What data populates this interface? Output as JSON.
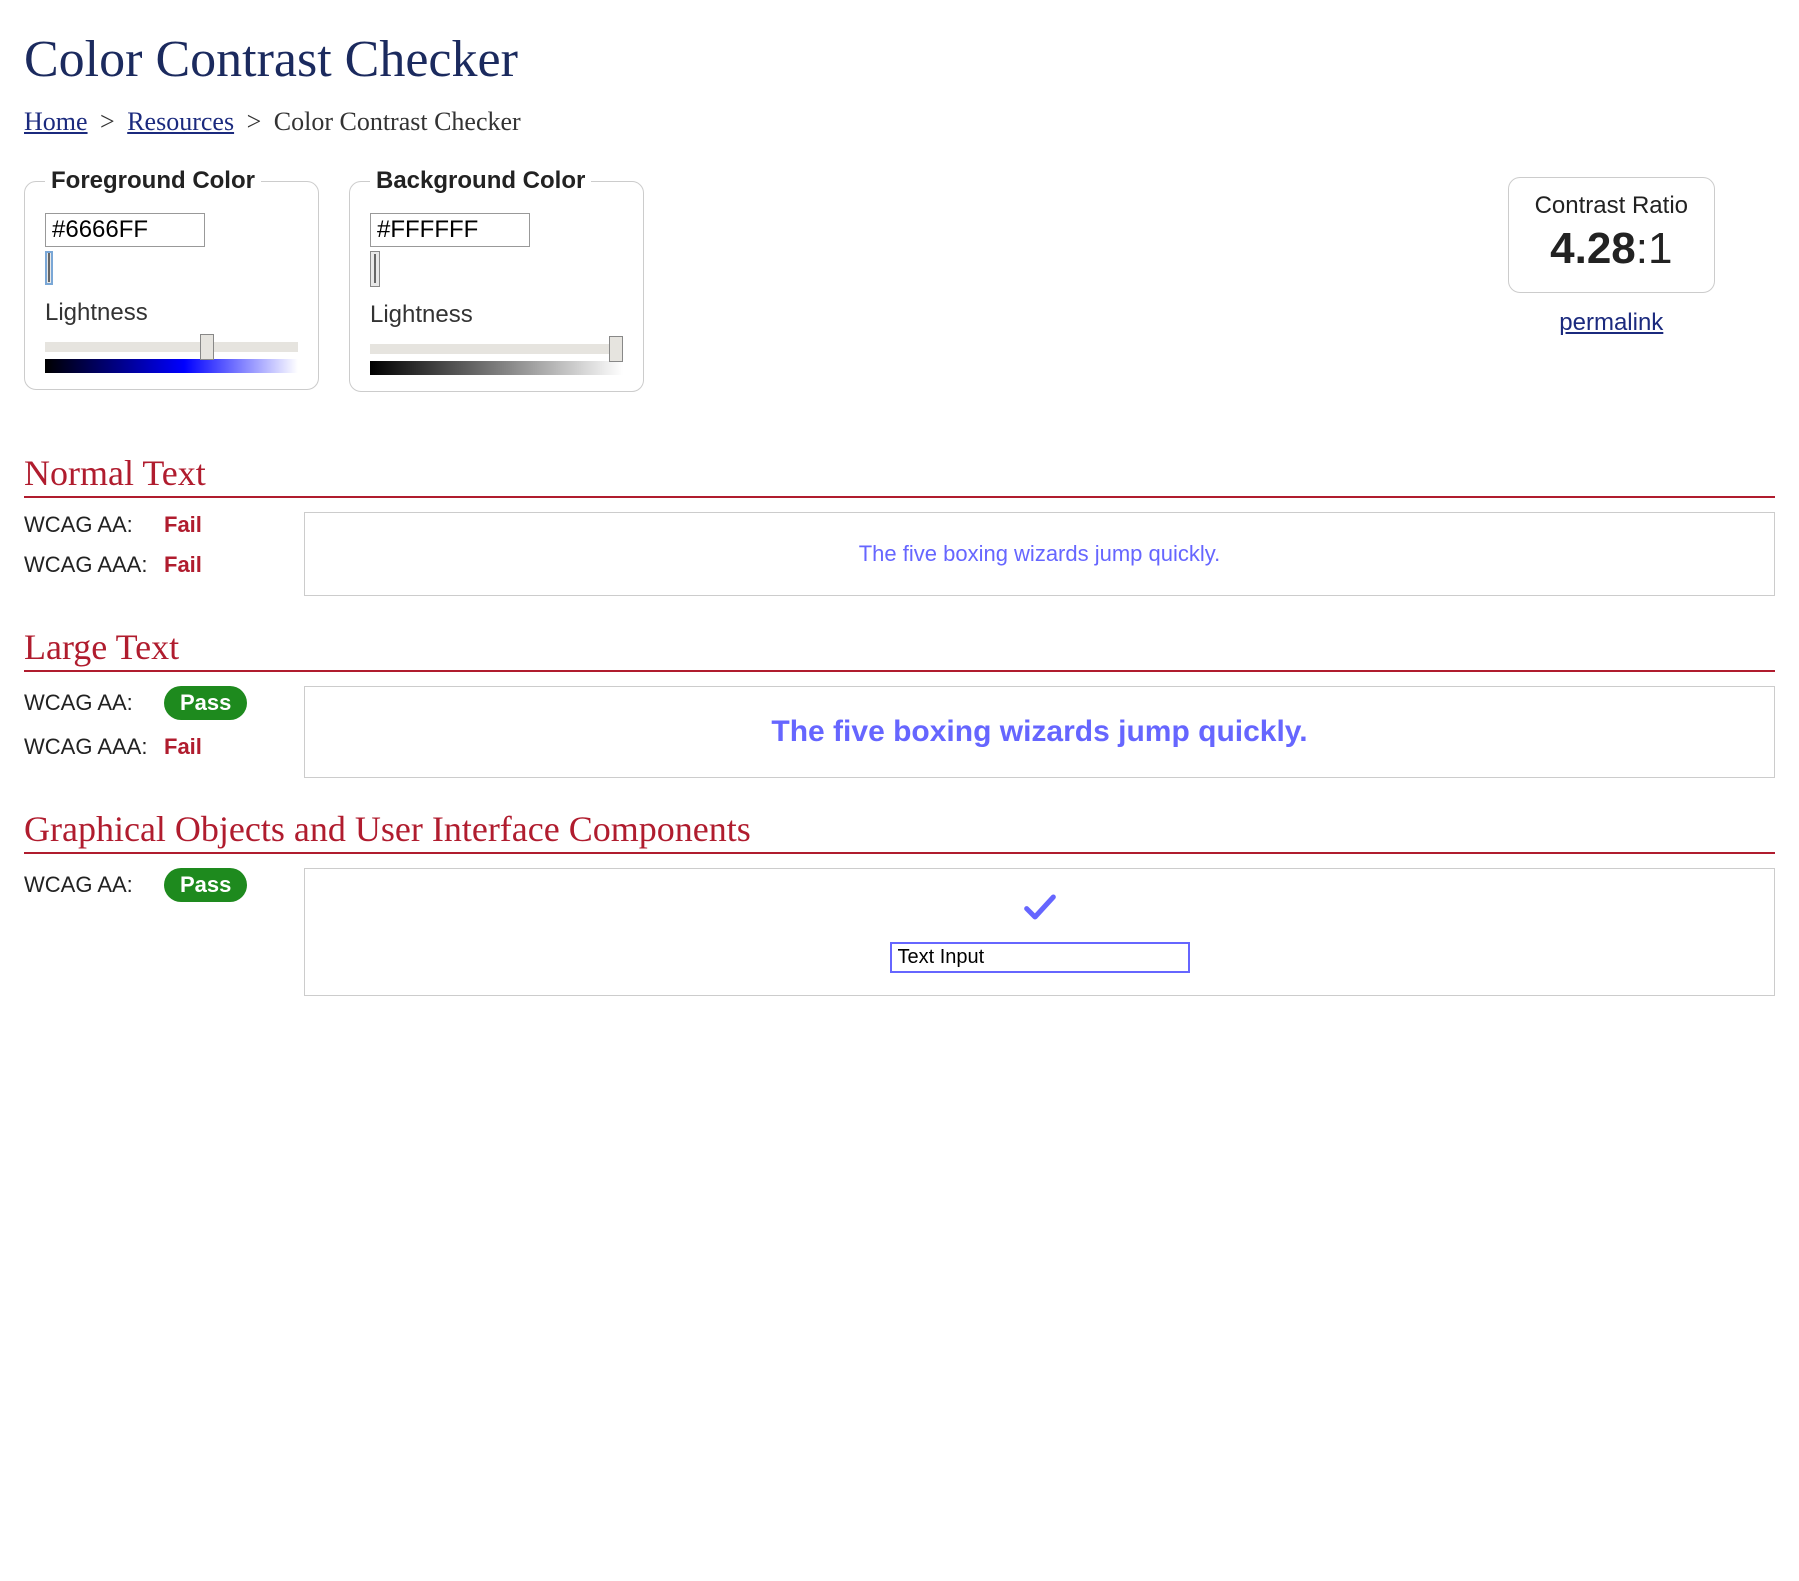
{
  "title": "Color Contrast Checker",
  "breadcrumb": {
    "home": "Home",
    "resources": "Resources",
    "current": "Color Contrast Checker",
    "sep": ">"
  },
  "foreground": {
    "legend": "Foreground Color",
    "hex": "#6666FF",
    "lightness_label": "Lightness",
    "slider_value": 65
  },
  "background": {
    "legend": "Background Color",
    "hex": "#FFFFFF",
    "lightness_label": "Lightness",
    "slider_value": 100
  },
  "ratio": {
    "title": "Contrast Ratio",
    "value": "4.28",
    "suffix": ":1",
    "permalink": "permalink"
  },
  "sections": {
    "normal": {
      "heading": "Normal Text",
      "aa_label": "WCAG AA:",
      "aa_result": "Fail",
      "aaa_label": "WCAG AAA:",
      "aaa_result": "Fail",
      "sample": "The five boxing wizards jump quickly."
    },
    "large": {
      "heading": "Large Text",
      "aa_label": "WCAG AA:",
      "aa_result": "Pass",
      "aaa_label": "WCAG AAA:",
      "aaa_result": "Fail",
      "sample": "The five boxing wizards jump quickly."
    },
    "ui": {
      "heading": "Graphical Objects and User Interface Components",
      "aa_label": "WCAG AA:",
      "aa_result": "Pass",
      "input_value": "Text Input"
    }
  },
  "colors": {
    "fg": "#6666FF",
    "bg": "#FFFFFF"
  }
}
